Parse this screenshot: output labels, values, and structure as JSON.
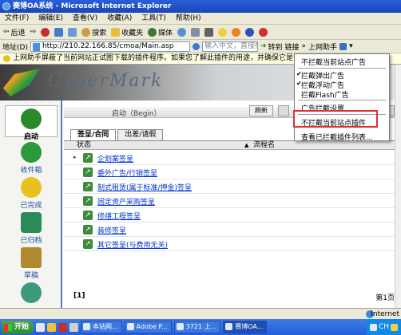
{
  "window": {
    "title": "赛博OA系统 - Microsoft Internet Explorer"
  },
  "menubar": {
    "items": [
      "文件(F)",
      "编辑(E)",
      "查看(V)",
      "收藏(A)",
      "工具(T)",
      "帮助(H)"
    ]
  },
  "toolbar": {
    "back": "后退",
    "search": "搜索",
    "favorites": "收藏夹",
    "media": "媒体",
    "links": "链接",
    "helper": "上网助手"
  },
  "address": {
    "label": "地址(D)",
    "url": "http://210.22.166.85/cmoa/Main.asp",
    "search_placeholder": "输入中文，直接搜索",
    "go": "转到"
  },
  "infobar": {
    "text": "上网助手屏蔽了当前网站正试图下载的插件程序。如果您了解此插件的用途，并确保它是安全的"
  },
  "banner": {
    "logo_text": "CyberMark"
  },
  "sidebar": {
    "items": [
      {
        "label": "启动",
        "active": true,
        "color": "#2a8a2a"
      },
      {
        "label": "收件箱",
        "active": false,
        "color": "#2a9a3a"
      },
      {
        "label": "已完成",
        "active": false,
        "color": "#e8c020"
      },
      {
        "label": "已归档",
        "active": false,
        "color": "#2a8a5a"
      },
      {
        "label": "草稿",
        "active": false,
        "color": "#b08830"
      }
    ]
  },
  "main": {
    "header_title": "启动（Begin）",
    "refresh_label": "刷新",
    "tabs": [
      {
        "label": "签呈/合同",
        "active": true
      },
      {
        "label": "出差/请假",
        "active": false
      }
    ],
    "table": {
      "col_status": "状态",
      "col_flow": "流程名",
      "rows": [
        "企划案签呈",
        "委外广告/行销签呈",
        "制式租赁(属于标准/押金)签呈",
        "固定资产采购签呈",
        "修缮工程签呈",
        "装修签呈",
        "其它签呈(与费用无关)"
      ]
    },
    "page_label": "[1]",
    "page_info": "第1页"
  },
  "dropdown": {
    "items": [
      {
        "label": "不拦截当前站点广告",
        "checked": false
      },
      {
        "label": "拦截弹出广告",
        "checked": true
      },
      {
        "label": "拦截浮动广告",
        "checked": true
      },
      {
        "label": "拦截Flash广告",
        "checked": false
      },
      {
        "label": "广告拦截设置",
        "checked": false
      },
      {
        "label": "不拦截当前站点插件",
        "checked": false
      },
      {
        "label": "查看已拦截插件列表...",
        "checked": false
      }
    ]
  },
  "statusbar": {
    "zone": "Internet"
  },
  "taskbar": {
    "start": "开始",
    "tasks": [
      {
        "label": "本站网...",
        "active": false
      },
      {
        "label": "Adobe P...",
        "active": false
      },
      {
        "label": "3721 上...",
        "active": false
      },
      {
        "label": "赛博OA...",
        "active": true
      }
    ],
    "tray_text": "CH"
  }
}
